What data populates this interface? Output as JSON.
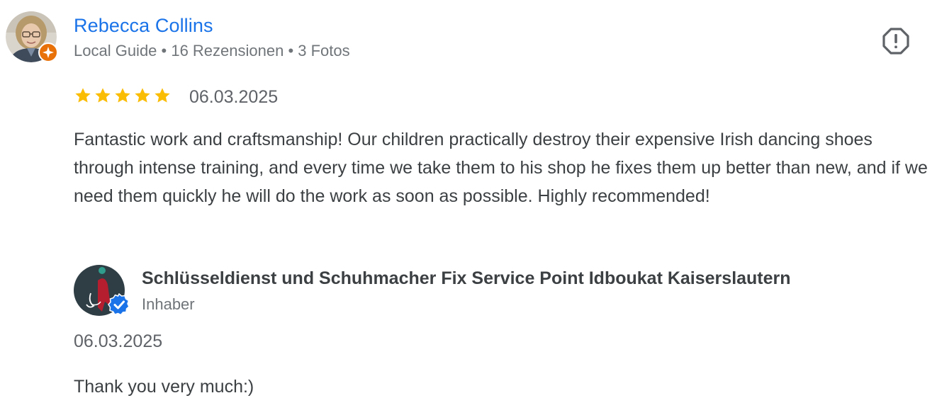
{
  "review": {
    "reviewer": {
      "name": "Rebecca Collins",
      "meta": "Local Guide • 16 Rezensionen • 3 Fotos",
      "avatar_icon": "user-photo",
      "badge_icon": "local-guide-badge-icon"
    },
    "rating": {
      "stars": 5,
      "max": 5,
      "star_color": "#fbbc04"
    },
    "date": "06.03.2025",
    "text": "Fantastic work and craftsmanship! Our children practically destroy their expensive Irish dancing shoes through intense training, and every time we take them to his shop he fixes them up better than new, and if we need them quickly he will do the work as soon as possible. Highly recommended!",
    "report_icon": "report-icon"
  },
  "owner_response": {
    "name": "Schlüsseldienst und Schuhmacher Fix Service Point Idboukat Kaiserslautern",
    "role": "Inhaber",
    "verified_icon": "verified-badge-icon",
    "date": "06.03.2025",
    "text": "Thank you very much:)"
  },
  "colors": {
    "accent_name": "#1a73e8",
    "text_primary": "#3c4043",
    "text_secondary": "#70757a",
    "star": "#fbbc04",
    "local_guide_badge": "#e8710a",
    "verified_badge": "#1a73e8"
  }
}
